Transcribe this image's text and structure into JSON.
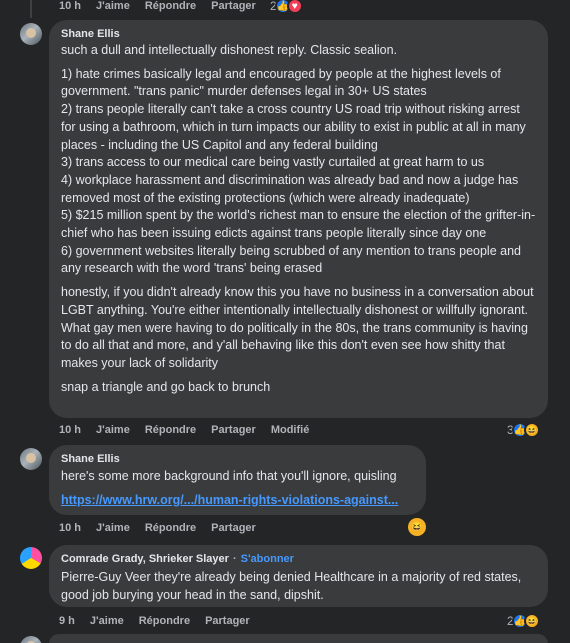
{
  "top_actions": {
    "time": "10 h",
    "like": "J'aime",
    "reply": "Répondre",
    "share": "Partager",
    "react_count": "2"
  },
  "comment1": {
    "author": "Shane Ellis",
    "lines": [
      "such a dull and intellectually dishonest reply. Classic sealion.",
      "1) hate crimes basically legal and encouraged by people at the highest levels of government. \"trans panic\" murder defenses legal in 30+ US states\n2) trans people literally can't take a cross country US road trip without risking arrest for using a bathroom, which in turn impacts our ability to exist in public at all in many places - including the US Capitol and any federal building\n3) trans access to our medical care being vastly curtailed at great harm to us\n4) workplace harassment and discrimination was already bad and now a judge has removed most of the existing protections (which were already inadequate)\n5) $215 million spent by the world's richest man to ensure the election of the grifter-in-chief who has been issuing edicts against trans people literally since day one\n6) government websites literally being scrubbed of any mention to trans people and any research with the word 'trans' being erased",
      "honestly, if you didn't already know this you have no business in a conversation about LGBT anything. You're either intentionally intellectually dishonest or willfully ignorant. What gay men were having to do politically in the 80s, the trans community is having to do all that and more, and y'all behaving like this don't even see how shitty that makes your lack of solidarity",
      "snap a triangle and go back to brunch"
    ],
    "actions": {
      "time": "10 h",
      "like": "J'aime",
      "reply": "Répondre",
      "share": "Partager",
      "edited": "Modifié"
    },
    "react_count": "3"
  },
  "comment2": {
    "author": "Shane Ellis",
    "text": "here's some more background info that you'll ignore, quisling",
    "link": "https://www.hrw.org/.../human-rights-violations-against...",
    "actions": {
      "time": "10 h",
      "like": "J'aime",
      "reply": "Répondre",
      "share": "Partager"
    }
  },
  "comment3": {
    "author": "Comrade Grady, Shrieker Slayer",
    "follow": "S'abonner",
    "text": "Pierre-Guy Veer they're already being denied Healthcare in a majority of red states, good job burying your head in the sand, dipshit.",
    "actions": {
      "time": "9 h",
      "like": "J'aime",
      "reply": "Répondre",
      "share": "Partager"
    },
    "react_count": "2"
  },
  "colors": {
    "background": "#242526",
    "bubble": "#3a3b3c",
    "link": "#4599ff",
    "like": "#1877f2",
    "love": "#f33e58",
    "haha": "#f7b125"
  }
}
